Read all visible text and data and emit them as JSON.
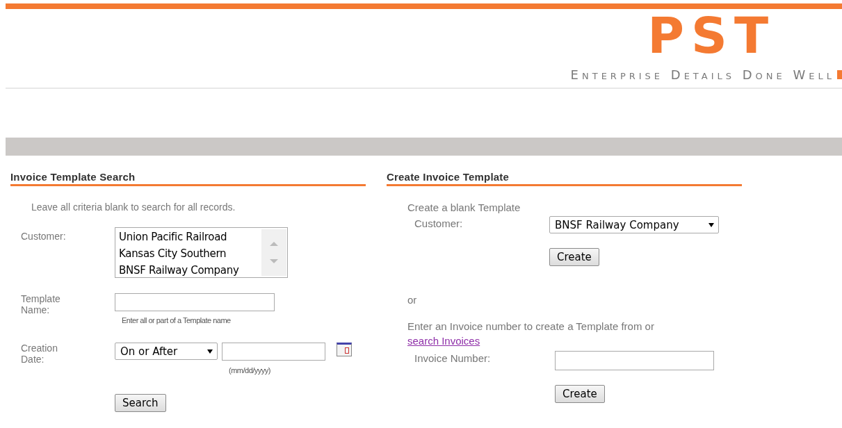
{
  "header": {
    "logo": "PST",
    "tagline": "Enterprise Details Done Well"
  },
  "search_panel": {
    "title": "Invoice Template Search",
    "hint": "Leave all criteria blank to search for all records.",
    "fields": [
      {
        "kind": "listbox",
        "label": "Customer:",
        "options": [
          "Union Pacific Railroad",
          "Kansas City Southern",
          "BNSF Railway Company"
        ]
      },
      {
        "kind": "text",
        "label": "Template Name:",
        "help": "Enter all or part of a Template name"
      },
      {
        "kind": "date",
        "label": "Creation Date:",
        "operator": "On or After",
        "help": "(mm/dd/yyyy)"
      }
    ],
    "button": "Search"
  },
  "create_panel": {
    "title": "Create Invoice Template",
    "blank_intro": "Create a blank Template",
    "customer_label": "Customer:",
    "customer_value": "BNSF Railway Company",
    "create_button": "Create",
    "separator": "or",
    "invoice_intro": "Enter an Invoice number to create a Template from or",
    "invoice_link": "search Invoices",
    "invoice_label": "Invoice Number:",
    "invoice_button": "Create"
  }
}
